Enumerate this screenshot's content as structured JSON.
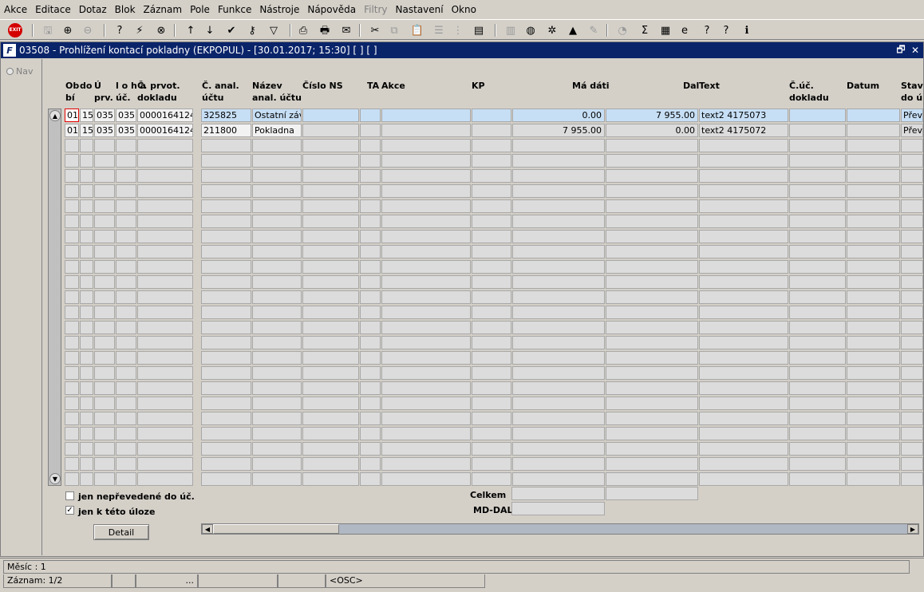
{
  "menu": [
    "Akce",
    "Editace",
    "Dotaz",
    "Blok",
    "Záznam",
    "Pole",
    "Funkce",
    "Nástroje",
    "Nápověda",
    "Filtry",
    "Nastavení",
    "Okno"
  ],
  "menu_disabled_index": 9,
  "toolbar": {
    "exit_label": "EXIT",
    "icons": [
      "exit-icon",
      "save-icon",
      "insert-record-icon",
      "delete-record-icon",
      "query-icon",
      "execute-query-icon",
      "cancel-query-icon",
      "sort-asc-icon",
      "sort-desc-icon",
      "check-icon",
      "key-icon",
      "filter-icon",
      "print-icon",
      "print-preview-icon",
      "mail-icon",
      "cut-icon",
      "copy-icon",
      "paste-icon",
      "list-icon",
      "tree-icon",
      "report-icon",
      "document-icon",
      "globe-icon",
      "wheel-icon",
      "chart-icon",
      "edit-icon",
      "calendar-icon",
      "sum-icon",
      "excel-icon",
      "ie-icon",
      "help-icon",
      "context-help-icon",
      "info-icon"
    ]
  },
  "window": {
    "title": "03508 - Prohlížení kontací pokladny (EKPOPUL) - [30.01.2017; 15:30]  [ ]  [ ]",
    "restore_glyph": "🗗",
    "close_glyph": "✕"
  },
  "nav": {
    "label": "Nav"
  },
  "table": {
    "headers": [
      {
        "lines": [
          "Ob",
          "bí"
        ]
      },
      {
        "lines": [
          "do",
          ""
        ]
      },
      {
        "lines": [
          "Ú",
          "prv."
        ]
      },
      {
        "lines": [
          "l o h a",
          "úč."
        ]
      },
      {
        "lines": [
          "Č. prvot.",
          "dokladu"
        ]
      },
      {
        "lines": [
          "Č. anal.",
          "účtu"
        ]
      },
      {
        "lines": [
          "Název",
          "anal. účtu"
        ]
      },
      {
        "lines": [
          "Číslo NS",
          ""
        ]
      },
      {
        "lines": [
          "TA",
          ""
        ]
      },
      {
        "lines": [
          "Akce",
          ""
        ]
      },
      {
        "lines": [
          "KP",
          ""
        ]
      },
      {
        "lines": [
          "Má dáti",
          ""
        ]
      },
      {
        "lines": [
          "Dal",
          ""
        ]
      },
      {
        "lines": [
          "Text",
          ""
        ]
      },
      {
        "lines": [
          "Č.úč.",
          "dokladu"
        ]
      },
      {
        "lines": [
          "Datum",
          ""
        ]
      },
      {
        "lines": [
          "Stav",
          "do ú"
        ]
      }
    ],
    "rows": [
      [
        "01",
        "15",
        "035",
        "035",
        "0000164124",
        "325825",
        "Ostatní záva",
        "",
        "",
        "",
        "",
        "0.00",
        "7 955.00",
        "text2 4175073",
        "",
        "",
        "Přev"
      ],
      [
        "01",
        "15",
        "035",
        "035",
        "0000164124",
        "211800",
        "Pokladna",
        "",
        "",
        "",
        "",
        "7 955.00",
        "0.00",
        "text2 4175072",
        "",
        "",
        "Přev"
      ]
    ],
    "empty_rows": 23
  },
  "filters": {
    "unposted_label": "jen nepřevedené do úč.",
    "unposted_checked": false,
    "task_label": "jen k této úloze",
    "task_checked": true,
    "check_glyph": "✓"
  },
  "detail_button": "Detail",
  "totals": {
    "total_label": "Celkem",
    "diff_label": "MD-DAL"
  },
  "status": {
    "message": "Měsíc : 1",
    "record": "Záznam: 1/2",
    "ellipsis": "...",
    "mode": "<OSC>"
  }
}
